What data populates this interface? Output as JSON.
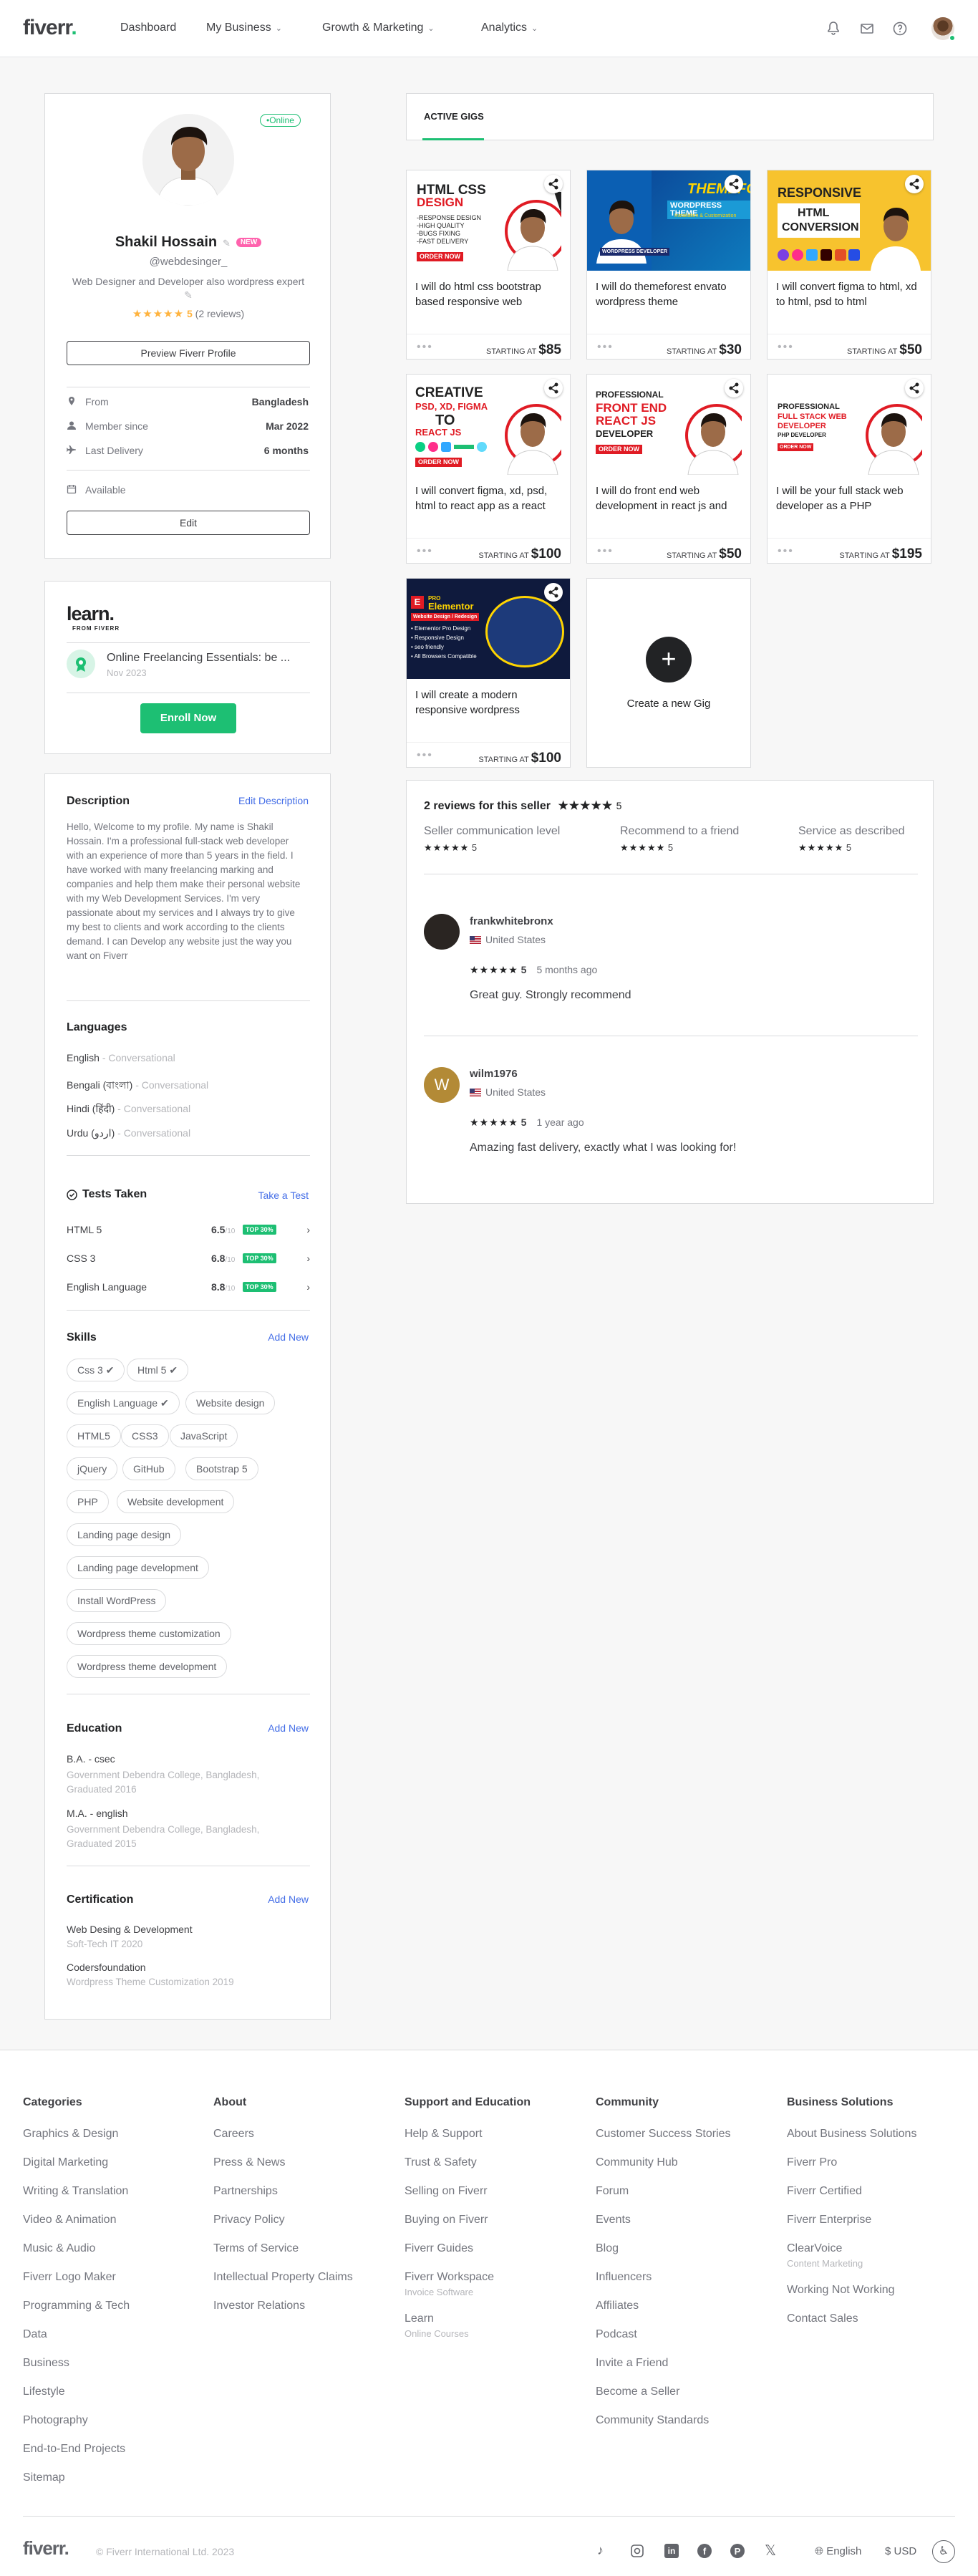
{
  "header": {
    "logo": "fiverr",
    "nav": [
      "Dashboard",
      "My Business",
      "Growth & Marketing",
      "Analytics"
    ]
  },
  "profile": {
    "status": "Online",
    "name": "Shakil Hossain",
    "badge": "NEW",
    "username": "@webdesinger_",
    "tagline": "Web Designer and Developer also wordpress expert",
    "rating": "5",
    "reviews": "(2 reviews)",
    "preview_button": "Preview Fiverr Profile",
    "info": [
      {
        "label": "From",
        "value": "Bangladesh"
      },
      {
        "label": "Member since",
        "value": "Mar 2022"
      },
      {
        "label": "Last Delivery",
        "value": "6 months"
      }
    ],
    "availability": "Available",
    "edit_button": "Edit"
  },
  "learn": {
    "logo": "learn.",
    "logo_sub": "FROM FIVERR",
    "course": "Online Freelancing Essentials: be ...",
    "date": "Nov 2023",
    "enroll_button": "Enroll Now"
  },
  "about": {
    "description_title": "Description",
    "description_edit": "Edit Description",
    "description": "Hello, Welcome to my profile. My name is Shakil Hossain. I'm a professional full-stack web developer with an experience of more than 5 years in the field. I have worked with many freelancing marking and companies and help them make their personal website with my Web Development Services. I'm very passionate about my services and I always try to give my best to clients and work according to the clients demand. I can Develop any website just the way you want on Fiverr",
    "languages_title": "Languages",
    "languages": [
      {
        "name": "English",
        "level": "Conversational"
      },
      {
        "name": "Bengali (বাংলা)",
        "level": "Conversational"
      },
      {
        "name": "Hindi (हिंदी)",
        "level": "Conversational"
      },
      {
        "name": "Urdu (اردو)",
        "level": "Conversational"
      }
    ],
    "tests_title": "Tests Taken",
    "tests_action": "Take a Test",
    "tests": [
      {
        "name": "HTML 5",
        "score": "6.5",
        "max": "/10",
        "badge": "TOP 30%"
      },
      {
        "name": "CSS 3",
        "score": "6.8",
        "max": "/10",
        "badge": "TOP 30%"
      },
      {
        "name": "English Language",
        "score": "8.8",
        "max": "/10",
        "badge": "TOP 30%"
      }
    ],
    "skills_title": "Skills",
    "skills_action": "Add New",
    "skills": [
      "Css 3",
      "Html 5",
      "English Language",
      "Website design",
      "HTML5",
      "CSS3",
      "JavaScript",
      "jQuery",
      "GitHub",
      "Bootstrap 5",
      "PHP",
      "Website development",
      "Landing page design",
      "Landing page development",
      "Install WordPress",
      "Wordpress theme customization",
      "Wordpress theme development"
    ],
    "education_title": "Education",
    "education_action": "Add New",
    "education": [
      {
        "degree": "B.A. - csec",
        "school": "Government Debendra College, Bangladesh, Graduated 2016"
      },
      {
        "degree": "M.A. - english",
        "school": "Government Debendra College, Bangladesh, Graduated 2015"
      }
    ],
    "cert_title": "Certification",
    "cert_action": "Add New",
    "certs": [
      {
        "name": "Web Desing & Development",
        "issuer": "Soft-Tech IT 2020"
      },
      {
        "name": "Codersfoundation",
        "issuer": "Wordpress Theme Customization 2019"
      }
    ]
  },
  "gigs": {
    "tab": "ACTIVE GIGS",
    "starting_at": "STARTING AT",
    "items": [
      {
        "title": "I will do html css bootstrap based responsive web",
        "price": "$85",
        "thumb": [
          "HTML CSS",
          "DESIGN",
          "-RESPONSE DESIGN",
          "-HIGH QUALITY",
          "-BUGS FIXING",
          "-FAST DELIVERY",
          "ORDER NOW"
        ]
      },
      {
        "title": "I will do themeforest envato wordpress theme",
        "price": "$30",
        "thumb": [
          "THEMEFOREST",
          "WORDPRESS THEME",
          "Installation & Customization",
          "WORDPRESS DEVELOPER"
        ]
      },
      {
        "title": "I will convert figma to html, xd to html, psd to html",
        "price": "$50",
        "thumb": [
          "RESPONSIVE",
          "HTML",
          "CONVERSION"
        ]
      },
      {
        "title": "I will convert figma, xd, psd, html to react app as a react",
        "price": "$100",
        "thumb": [
          "CREATIVE",
          "PSD, XD, FIGMA",
          "TO",
          "REACT JS",
          "ORDER NOW"
        ]
      },
      {
        "title": "I will do front end web development in react js and",
        "price": "$50",
        "thumb": [
          "PROFESSIONAL",
          "FRONT END",
          "REACT JS",
          "DEVELOPER",
          "ORDER NOW"
        ]
      },
      {
        "title": "I will be your full stack web developer as a PHP",
        "price": "$195",
        "thumb": [
          "PROFESSIONAL",
          "FULL STACK WEB",
          "DEVELOPER",
          "PHP DEVELOPER",
          "ORDER NOW"
        ]
      },
      {
        "title": "I will create a modern responsive wordpress",
        "price": "$100",
        "thumb": [
          "PRO",
          "Elementor",
          "Website Design / Redesign",
          "• Elementor Pro Design",
          "• Responsive Design",
          "• seo friendly",
          "• All Browsers Compatible"
        ]
      }
    ],
    "create_label": "Create a new Gig"
  },
  "reviews": {
    "title": "2 reviews for this seller",
    "rating": "5",
    "breakdown": [
      {
        "label": "Seller communication level",
        "value": "5"
      },
      {
        "label": "Recommend to a friend",
        "value": "5"
      },
      {
        "label": "Service as described",
        "value": "5"
      }
    ],
    "items": [
      {
        "user": "frankwhitebronx",
        "country": "United States",
        "rating": "5",
        "time": "5 months ago",
        "text": "Great guy. Strongly recommend",
        "initial": ""
      },
      {
        "user": "wilm1976",
        "country": "United States",
        "rating": "5",
        "time": "1 year ago",
        "text": "Amazing fast delivery, exactly what I was looking for!",
        "initial": "W"
      }
    ]
  },
  "footer": {
    "columns": [
      {
        "title": "Categories",
        "links": [
          "Graphics & Design",
          "Digital Marketing",
          "Writing & Translation",
          "Video & Animation",
          "Music & Audio",
          "Fiverr Logo Maker",
          "Programming & Tech",
          "Data",
          "Business",
          "Lifestyle",
          "Photography",
          "End-to-End Projects",
          "Sitemap"
        ]
      },
      {
        "title": "About",
        "links": [
          "Careers",
          "Press & News",
          "Partnerships",
          "Privacy Policy",
          "Terms of Service",
          "Intellectual Property Claims",
          "Investor Relations"
        ]
      },
      {
        "title": "Support and Education",
        "links": [
          "Help & Support",
          "Trust & Safety",
          "Selling on Fiverr",
          "Buying on Fiverr",
          "Fiverr Guides",
          "Fiverr Workspace",
          "Learn"
        ],
        "subs": {
          "5": "Invoice Software",
          "6": "Online Courses"
        }
      },
      {
        "title": "Community",
        "links": [
          "Customer Success Stories",
          "Community Hub",
          "Forum",
          "Events",
          "Blog",
          "Influencers",
          "Affiliates",
          "Podcast",
          "Invite a Friend",
          "Become a Seller",
          "Community Standards"
        ]
      },
      {
        "title": "Business Solutions",
        "links": [
          "About Business Solutions",
          "Fiverr Pro",
          "Fiverr Certified",
          "Fiverr Enterprise",
          "ClearVoice",
          "Working Not Working",
          "Contact Sales"
        ],
        "subs": {
          "4": "Content Marketing"
        }
      }
    ],
    "logo": "fiverr",
    "copyright": "© Fiverr International Ltd. 2023",
    "language": "English",
    "currency": "$ USD"
  },
  "colors": {
    "brand": "#1dbf73",
    "link": "#446ee7",
    "star": "#ffb33e",
    "badge_new": "#ff62ad"
  }
}
